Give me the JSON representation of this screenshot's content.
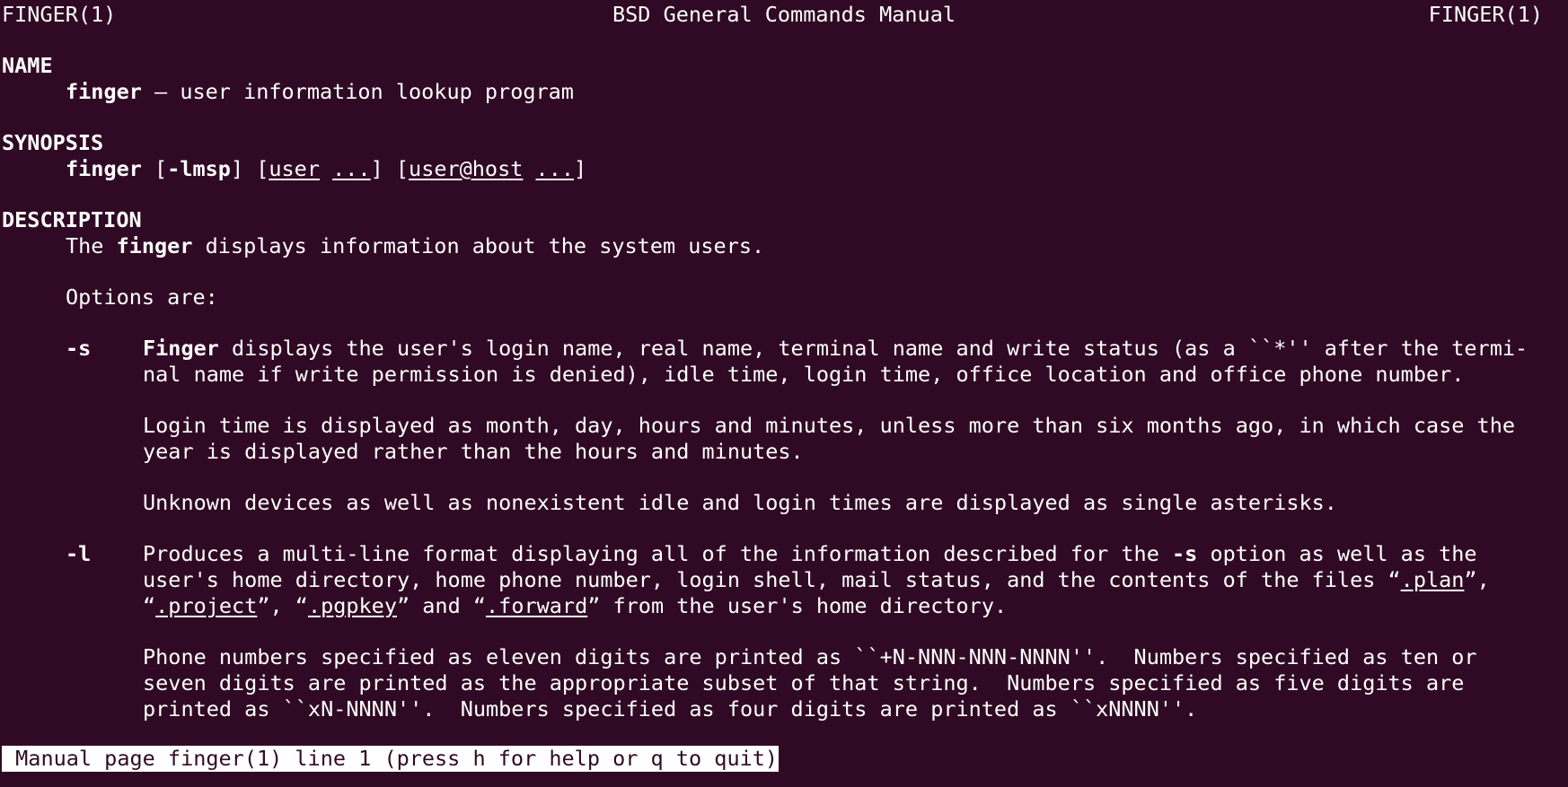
{
  "header": {
    "left": "FINGER(1)",
    "center": "BSD General Commands Manual",
    "right": "FINGER(1)"
  },
  "sections": {
    "name": {
      "heading": "NAME",
      "cmd": "finger",
      "rest": " — user information lookup program"
    },
    "synopsis": {
      "heading": "SYNOPSIS",
      "cmd": "finger",
      "p1": " [",
      "flags": "-lmsp",
      "p2": "] [",
      "user": "user",
      "p3": " ",
      "dots1": "...",
      "p4": "] [",
      "userhost": "user@host",
      "p5": " ",
      "dots2": "...",
      "p6": "]"
    },
    "description": {
      "heading": "DESCRIPTION",
      "intro_pre": "The ",
      "intro_cmd": "finger",
      "intro_post": " displays information about the system users.",
      "options_intro": "Options are:"
    }
  },
  "options": {
    "s": {
      "flag": "-s",
      "l1_bold": "Finger",
      "l1_rest": " displays the user's login name, real name, terminal name and write status (as a ``*'' after the termi-",
      "l2": "nal name if write permission is denied), idle time, login time, office location and office phone number.",
      "p2_l1": "Login time is displayed as month, day, hours and minutes, unless more than six months ago, in which case the",
      "p2_l2": "year is displayed rather than the hours and minutes.",
      "p3_l1": "Unknown devices as well as nonexistent idle and login times are displayed as single asterisks."
    },
    "l": {
      "flag": "-l",
      "l1_pre": "Produces a multi-line format displaying all of the information described for the ",
      "l1_bold": "-s",
      "l1_post": " option as well as the",
      "l2_pre": "user's home directory, home phone number, login shell, mail status, and the contents of the files “",
      "l2_plan": ".plan",
      "l2_post": "”,",
      "l3_a": "“",
      "l3_project": ".project",
      "l3_b": "”, “",
      "l3_pgpkey": ".pgpkey",
      "l3_c": "” and “",
      "l3_forward": ".forward",
      "l3_d": "” from the user's home directory.",
      "p2_l1": "Phone numbers specified as eleven digits are printed as ``+N-NNN-NNN-NNNN''.  Numbers specified as ten or",
      "p2_l2": "seven digits are printed as the appropriate subset of that string.  Numbers specified as five digits are",
      "p2_l3": "printed as ``xN-NNNN''.  Numbers specified as four digits are printed as ``xNNNN''."
    }
  },
  "status_bar": {
    "text": " Manual page finger(1) line 1 (press h for help or q to quit)"
  }
}
